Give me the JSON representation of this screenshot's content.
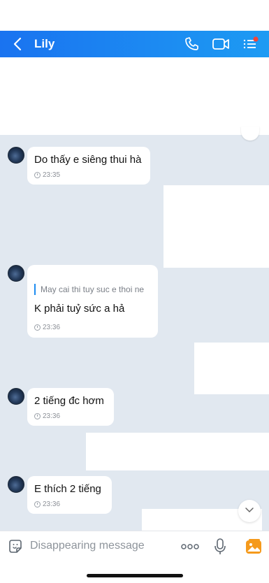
{
  "header": {
    "title": "Lily"
  },
  "messages": [
    {
      "text": "Do thấy e siêng thui hà",
      "time": "23:35"
    },
    {
      "quote": "May cai thi tuy suc e thoi ne",
      "text": "K phải tuỷ sức a hả",
      "time": "23:36"
    },
    {
      "text": "2 tiếng đc hơm",
      "time": "23:36"
    },
    {
      "text": "E thích 2 tiếng",
      "time": "23:36"
    }
  ],
  "input": {
    "placeholder": "Disappearing message"
  },
  "colors": {
    "header": "#1a73f0",
    "chat_bg": "#e1e8f0",
    "accent": "#1d8cf0",
    "badge": "#f0443a"
  }
}
